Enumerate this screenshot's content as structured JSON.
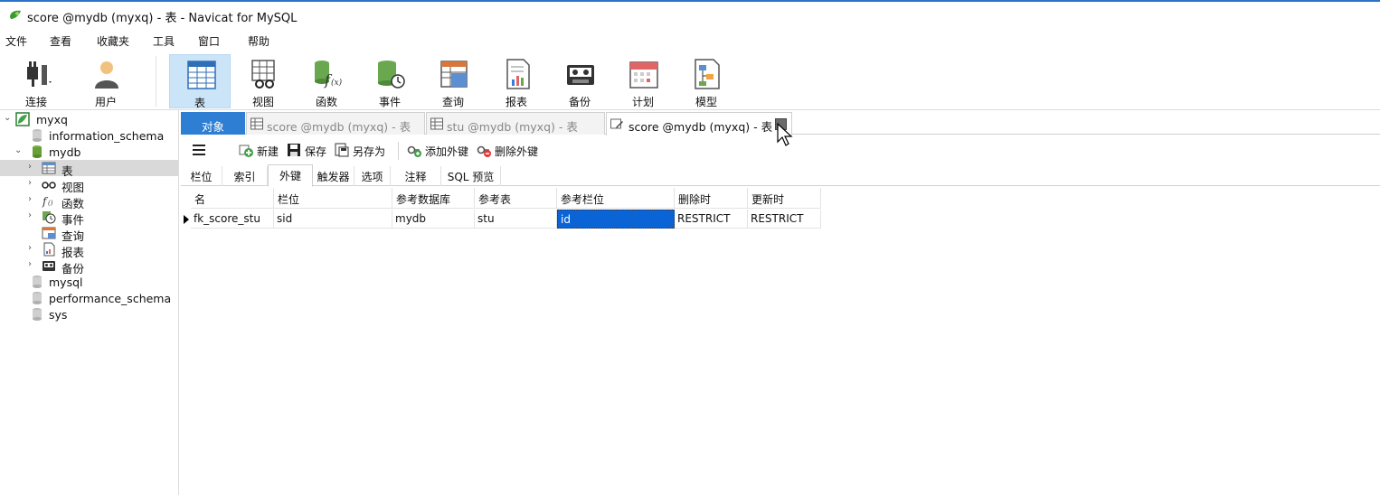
{
  "window": {
    "title": "score @mydb (myxq) - 表 - Navicat for MySQL"
  },
  "menu": [
    "文件",
    "查看",
    "收藏夹",
    "工具",
    "窗口",
    "帮助"
  ],
  "toolbar": [
    {
      "label": "连接",
      "icon": "plug-icon"
    },
    {
      "label": "用户",
      "icon": "user-icon"
    },
    {
      "label": "表",
      "icon": "table-icon",
      "active": true
    },
    {
      "label": "视图",
      "icon": "view-icon"
    },
    {
      "label": "函数",
      "icon": "function-icon"
    },
    {
      "label": "事件",
      "icon": "event-icon"
    },
    {
      "label": "查询",
      "icon": "query-icon"
    },
    {
      "label": "报表",
      "icon": "report-icon"
    },
    {
      "label": "备份",
      "icon": "backup-icon"
    },
    {
      "label": "计划",
      "icon": "schedule-icon"
    },
    {
      "label": "模型",
      "icon": "model-icon"
    }
  ],
  "tree": [
    {
      "label": "myxq",
      "icon": "connection-icon",
      "expanded": true
    },
    {
      "label": "information_schema",
      "icon": "database-icon"
    },
    {
      "label": "mydb",
      "icon": "database-icon",
      "expanded": true
    },
    {
      "label": "表",
      "icon": "table-icon",
      "selected": true
    },
    {
      "label": "视图",
      "icon": "view-icon"
    },
    {
      "label": "函数",
      "icon": "function-icon"
    },
    {
      "label": "事件",
      "icon": "event-icon"
    },
    {
      "label": "查询",
      "icon": "query-icon"
    },
    {
      "label": "报表",
      "icon": "report-icon"
    },
    {
      "label": "备份",
      "icon": "backup-icon"
    },
    {
      "label": "mysql",
      "icon": "database-icon"
    },
    {
      "label": "performance_schema",
      "icon": "database-icon"
    },
    {
      "label": "sys",
      "icon": "database-icon"
    }
  ],
  "tabs": [
    {
      "label": "对象",
      "active_blue": true
    },
    {
      "label": "score @mydb (myxq) - 表"
    },
    {
      "label": "stu @mydb (myxq) - 表"
    },
    {
      "label": "score @mydb (myxq) - 表",
      "current": true
    }
  ],
  "object_toolbar": {
    "new": "新建",
    "save": "保存",
    "save_as": "另存为",
    "add_fk": "添加外键",
    "delete_fk": "删除外键"
  },
  "subtabs": [
    "栏位",
    "索引",
    "外键",
    "触发器",
    "选项",
    "注释",
    "SQL 预览"
  ],
  "active_subtab": "外键",
  "grid": {
    "columns": [
      "名",
      "栏位",
      "参考数据库",
      "参考表",
      "参考栏位",
      "删除时",
      "更新时"
    ],
    "rows": [
      [
        "fk_score_stu",
        "sid",
        "mydb",
        "stu",
        "id",
        "RESTRICT",
        "RESTRICT"
      ]
    ]
  },
  "colors": {
    "accent": "#0a64d6",
    "active_tab": "#2e7fd4",
    "toolbar_active": "#cce4f7"
  }
}
